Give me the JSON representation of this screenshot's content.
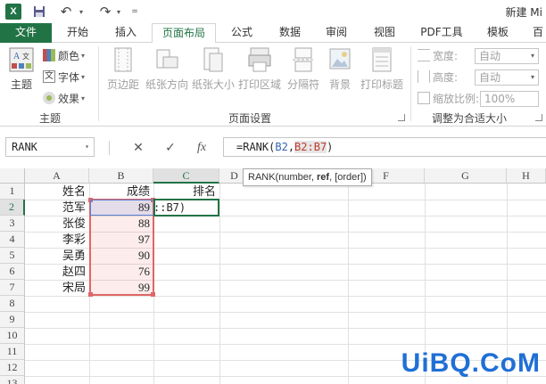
{
  "titlebar": {
    "app_logo": "X",
    "doc_title": "新建 Mi"
  },
  "tabs": [
    {
      "label": "文件"
    },
    {
      "label": "开始"
    },
    {
      "label": "插入"
    },
    {
      "label": "页面布局"
    },
    {
      "label": "公式"
    },
    {
      "label": "数据"
    },
    {
      "label": "审阅"
    },
    {
      "label": "视图"
    },
    {
      "label": "PDF工具"
    },
    {
      "label": "模板"
    },
    {
      "label": "百"
    }
  ],
  "ribbon": {
    "themes": {
      "label": "主题",
      "main": "主题",
      "colors": "颜色",
      "fonts": "字体",
      "effects": "效果"
    },
    "page_setup": {
      "label": "页面设置",
      "margins": "页边距",
      "orientation": "纸张方向",
      "size": "纸张大小",
      "print_area": "打印区域",
      "breaks": "分隔符",
      "background": "背景",
      "print_titles": "打印标题"
    },
    "scale": {
      "label": "调整为合适大小",
      "width_label": "宽度:",
      "width_value": "自动",
      "height_label": "高度:",
      "height_value": "自动",
      "scale_label": "缩放比例:",
      "scale_value": "100%"
    }
  },
  "formula_bar": {
    "name_box": "RANK",
    "cancel": "✕",
    "enter": "✓",
    "fx": "fx",
    "formula_prefix": "=RANK(",
    "formula_ref1": "B2",
    "formula_sep": ",",
    "formula_ref2": "B2:B7",
    "formula_suffix": ")"
  },
  "tooltip": {
    "pre": "RANK(number, ",
    "bold": "ref",
    "post": ", [order])"
  },
  "grid": {
    "columns": [
      "A",
      "B",
      "C",
      "D",
      "E",
      "F",
      "G",
      "H"
    ],
    "rows": [
      "1",
      "2",
      "3",
      "4",
      "5",
      "6",
      "7",
      "8",
      "9",
      "10",
      "11",
      "12",
      "13"
    ],
    "header_row": {
      "A": "姓名",
      "B": "成绩",
      "C": "排名"
    },
    "records": [
      {
        "name": "范军",
        "score": "89"
      },
      {
        "name": "张俊",
        "score": "88"
      },
      {
        "name": "李彩",
        "score": "97"
      },
      {
        "name": "吴勇",
        "score": "90"
      },
      {
        "name": "赵四",
        "score": "76"
      },
      {
        "name": "宋局",
        "score": "99"
      }
    ],
    "editing_text": "::B7)"
  },
  "watermark": "UiBQ.CoM",
  "colors": {
    "excel_green": "#217346",
    "ref_blue": "#3465b0",
    "ref_red": "#c0392b"
  }
}
